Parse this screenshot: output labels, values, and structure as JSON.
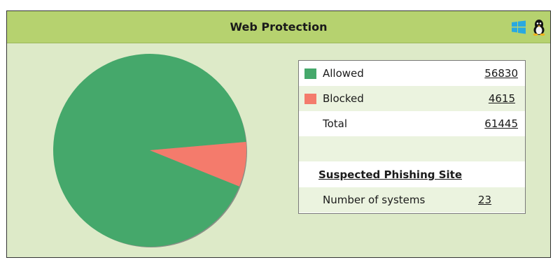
{
  "widget": {
    "title": "Web Protection",
    "os_icons": [
      "windows-icon",
      "linux-icon"
    ]
  },
  "stats": {
    "allowed": {
      "label": "Allowed",
      "value": "56830",
      "color": "#45a86b"
    },
    "blocked": {
      "label": "Blocked",
      "value": "4615",
      "color": "#f47b6c"
    },
    "total": {
      "label": "Total",
      "value": "61445"
    }
  },
  "phishing": {
    "title": "Suspected Phishing Site",
    "systems_label": "Number of systems",
    "systems_value": "23"
  },
  "chart_data": {
    "type": "pie",
    "categories": [
      "Allowed",
      "Blocked"
    ],
    "values": [
      56830,
      4615
    ],
    "colors": [
      "#45a86b",
      "#f47b6c"
    ]
  }
}
